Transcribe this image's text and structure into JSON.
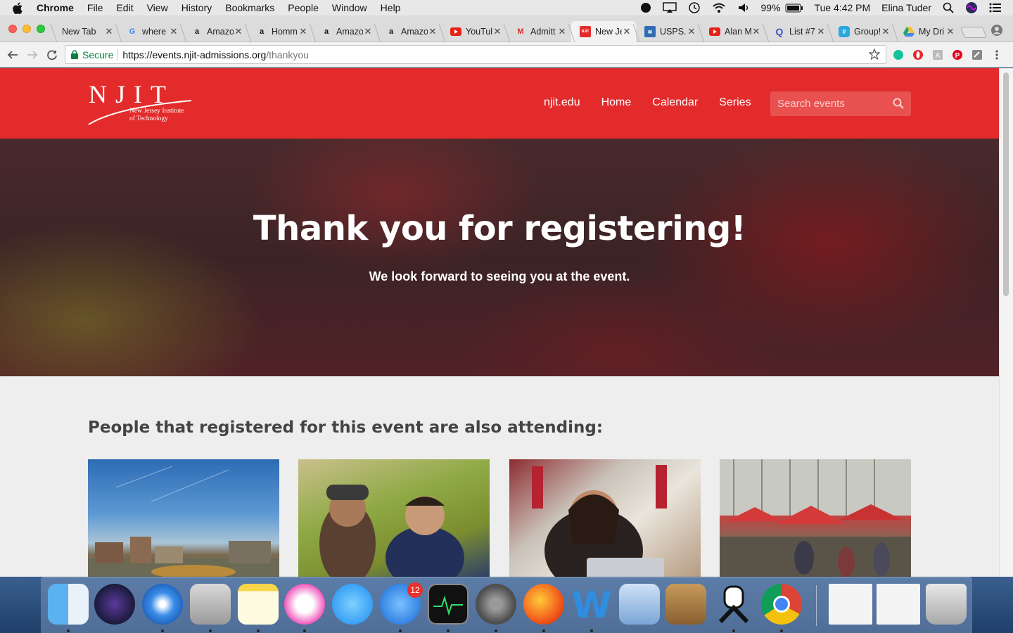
{
  "menubar": {
    "app_name": "Chrome",
    "menus": [
      "File",
      "Edit",
      "View",
      "History",
      "Bookmarks",
      "People",
      "Window",
      "Help"
    ],
    "battery": "99%",
    "clock": "Tue 4:42 PM",
    "user": "Elina Tuder"
  },
  "tabs": [
    {
      "label": "New Tab",
      "icon": "none",
      "active": false
    },
    {
      "label": "where",
      "icon": "google-icon",
      "active": false
    },
    {
      "label": "Amazo",
      "icon": "amazon-icon",
      "active": false
    },
    {
      "label": "Homm",
      "icon": "amazon-icon",
      "active": false
    },
    {
      "label": "Amazo",
      "icon": "amazon-icon",
      "active": false
    },
    {
      "label": "Amazo",
      "icon": "amazon-icon",
      "active": false
    },
    {
      "label": "YouTul",
      "icon": "youtube-icon",
      "active": false
    },
    {
      "label": "Admitt",
      "icon": "gmail-icon",
      "active": false
    },
    {
      "label": "New Je",
      "icon": "njit-icon",
      "active": true
    },
    {
      "label": "USPS.",
      "icon": "usps-icon",
      "active": false
    },
    {
      "label": "Alan M",
      "icon": "youtube-icon",
      "active": false
    },
    {
      "label": "List #7",
      "icon": "quizlet-icon",
      "active": false
    },
    {
      "label": "Group!",
      "icon": "groupme-icon",
      "active": false
    },
    {
      "label": "My Dri",
      "icon": "drive-icon",
      "active": false
    }
  ],
  "address_bar": {
    "secure_label": "Secure",
    "url_host": "https://events.njit-admissions.org",
    "url_path": "/thankyou"
  },
  "site": {
    "logo_text": "NJIT",
    "logo_sub_line1": "New Jersey Institute",
    "logo_sub_line2": "of Technology",
    "nav": [
      "njit.edu",
      "Home",
      "Calendar",
      "Series"
    ],
    "search_placeholder": "Search events",
    "hero_title": "Thank you for registering!",
    "hero_subtitle": "We look forward to seeing you at the event.",
    "also_heading": "People that registered for this event are also attending:"
  },
  "dock": {
    "apps": [
      "Finder",
      "Siri",
      "Safari",
      "Calculator",
      "Notes",
      "iTunes",
      "Messages",
      "App Store",
      "Activity Monitor",
      "System Preferences",
      "Firefox",
      "Word",
      "Mail Preview",
      "Contacts",
      "Fame",
      "Chrome"
    ],
    "app_store_badge": "12"
  },
  "colors": {
    "njit_red": "#e42b2b",
    "secure_green": "#0b8043"
  }
}
